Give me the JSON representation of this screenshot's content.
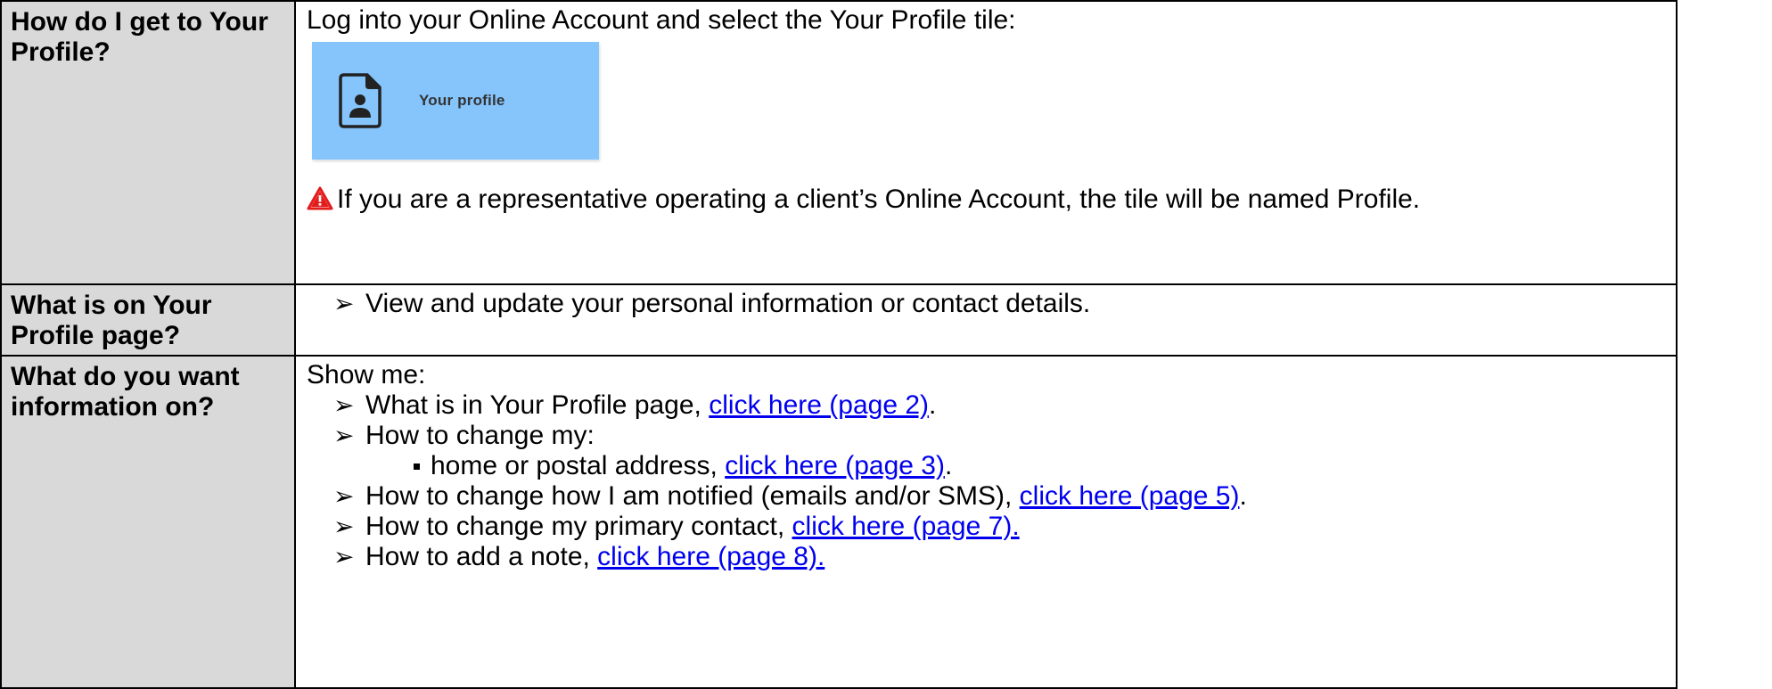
{
  "rows": [
    {
      "question": "How do I get to Your Profile?",
      "intro": "Log into your Online Account and select the Your Profile tile:",
      "tile_label": "Your profile",
      "tile_color": "#85c5fc",
      "tile_icon": "profile-document-icon",
      "warning_icon": "warning-triangle-icon",
      "warning_text": "If you are a representative operating a client’s Online Account, the tile will be named Profile."
    },
    {
      "question": "What is on Your Profile page?",
      "bullet": "View and update your personal information or contact details."
    },
    {
      "question": "What do you want information on?",
      "intro": "Show me:",
      "items": [
        {
          "text": "What is in Your Profile page, ",
          "link": "click here (page 2)",
          "after": "."
        },
        {
          "text": "How to change my:"
        },
        {
          "text": "home or postal address, ",
          "link": "click here (page 3)",
          "after": "."
        },
        {
          "text": "How to change how I am notified (emails and/or SMS), ",
          "link": "click here (page 5)",
          "after": "."
        },
        {
          "text": "How to change my primary contact, ",
          "link": "click here (page 7)."
        },
        {
          "text": "How to add a note, ",
          "link": "click here (page 8)."
        }
      ]
    }
  ],
  "colors": {
    "header_bg": "#d9d9d9",
    "link": "#0000ee",
    "warning": "#e31b1b"
  }
}
